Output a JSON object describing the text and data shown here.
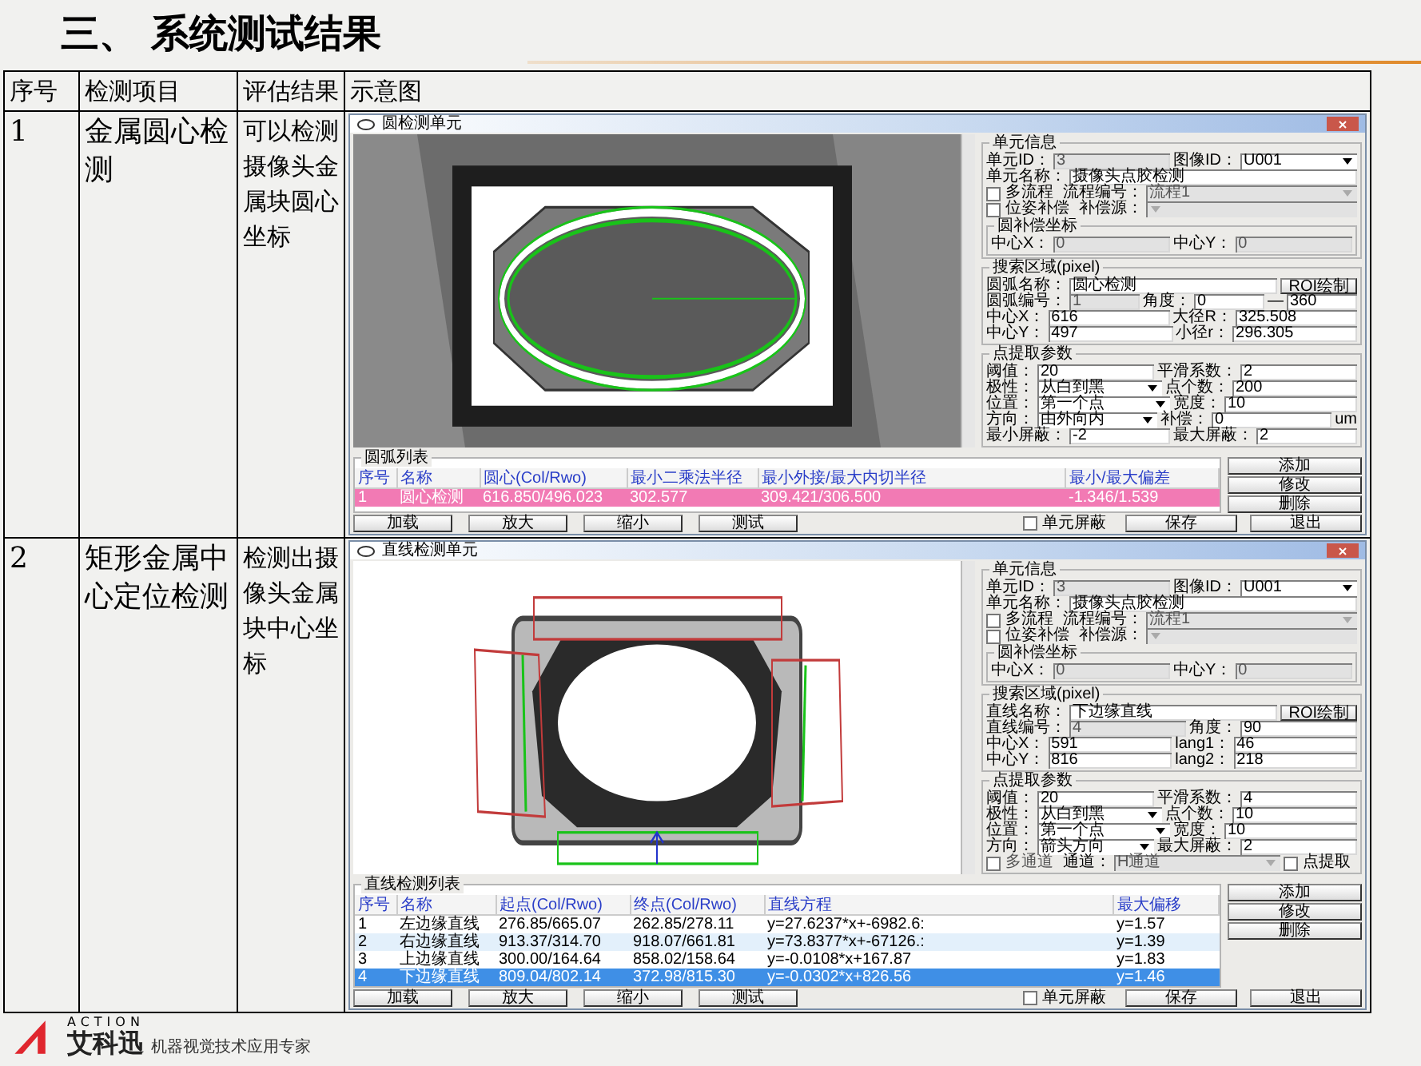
{
  "title": "三、 系统测试结果",
  "table": {
    "columns": [
      "序号",
      "检测项目",
      "评估结果",
      "示意图"
    ],
    "rows": [
      {
        "index": "1",
        "item": "金属圆心检测",
        "result": "可以检测摄像头金属块圆心坐标",
        "dialog": {
          "title": "圆检测单元",
          "kind": "circle",
          "groups": [
            {
              "title": "单元信息",
              "lines": [
                {
                  "items": [
                    {
                      "kind": "label",
                      "text": "单元ID："
                    },
                    {
                      "kind": "input",
                      "value": "3",
                      "disabled": true
                    },
                    {
                      "kind": "label",
                      "text": "图像ID："
                    },
                    {
                      "kind": "select",
                      "value": "U001",
                      "disabled": false
                    }
                  ]
                },
                {
                  "items": [
                    {
                      "kind": "label",
                      "text": "单元名称："
                    },
                    {
                      "kind": "input",
                      "value": "摄像头点胶检测",
                      "disabled": false
                    }
                  ]
                },
                {
                  "items": [
                    {
                      "kind": "check",
                      "label": "多流程",
                      "checked": false,
                      "disabled": false
                    },
                    {
                      "kind": "label",
                      "text": "流程编号："
                    },
                    {
                      "kind": "select",
                      "value": "流程1",
                      "disabled": true
                    }
                  ]
                },
                {
                  "items": [
                    {
                      "kind": "check",
                      "label": "位姿补偿",
                      "checked": false,
                      "disabled": false
                    },
                    {
                      "kind": "label",
                      "text": "补偿源："
                    },
                    {
                      "kind": "select",
                      "disabled": true
                    }
                  ]
                }
              ],
              "children": [
                {
                  "title": "圆补偿坐标",
                  "lines": [
                    {
                      "items": [
                        {
                          "kind": "label",
                          "text": "中心X："
                        },
                        {
                          "kind": "input",
                          "value": "0",
                          "disabled": true
                        },
                        {
                          "kind": "label",
                          "text": "中心Y："
                        },
                        {
                          "kind": "input",
                          "value": "0",
                          "disabled": true
                        }
                      ]
                    }
                  ]
                }
              ]
            },
            {
              "title": "搜索区域(pixel)",
              "lines": [
                {
                  "items": [
                    {
                      "kind": "label",
                      "text": "圆弧名称："
                    },
                    {
                      "kind": "input",
                      "value": "圆心检测",
                      "disabled": false
                    },
                    {
                      "kind": "button",
                      "label": "ROI绘制"
                    }
                  ]
                },
                {
                  "items": [
                    {
                      "kind": "label",
                      "text": "圆弧编号："
                    },
                    {
                      "kind": "input",
                      "value": "1",
                      "disabled": true
                    },
                    {
                      "kind": "label",
                      "text": "角度："
                    },
                    {
                      "kind": "input",
                      "value": "0",
                      "disabled": false
                    },
                    {
                      "kind": "label",
                      "text": "—"
                    },
                    {
                      "kind": "input",
                      "value": "360",
                      "disabled": false
                    }
                  ]
                },
                {
                  "items": [
                    {
                      "kind": "label",
                      "text": "中心X："
                    },
                    {
                      "kind": "input",
                      "value": "616",
                      "disabled": false
                    },
                    {
                      "kind": "label",
                      "text": "大径R："
                    },
                    {
                      "kind": "input",
                      "value": "325.508",
                      "disabled": false
                    }
                  ]
                },
                {
                  "items": [
                    {
                      "kind": "label",
                      "text": "中心Y："
                    },
                    {
                      "kind": "input",
                      "value": "497",
                      "disabled": false
                    },
                    {
                      "kind": "label",
                      "text": "小径r："
                    },
                    {
                      "kind": "input",
                      "value": "296.305",
                      "disabled": false
                    }
                  ]
                }
              ]
            },
            {
              "title": "点提取参数",
              "lines": [
                {
                  "items": [
                    {
                      "kind": "label",
                      "text": "阈值："
                    },
                    {
                      "kind": "input",
                      "value": "20",
                      "disabled": false
                    },
                    {
                      "kind": "label",
                      "text": "平滑系数："
                    },
                    {
                      "kind": "input",
                      "value": "2",
                      "disabled": false
                    }
                  ]
                },
                {
                  "items": [
                    {
                      "kind": "label",
                      "text": "极性："
                    },
                    {
                      "kind": "select",
                      "value": "从白到黑",
                      "disabled": false
                    },
                    {
                      "kind": "label",
                      "text": "点个数："
                    },
                    {
                      "kind": "input",
                      "value": "200",
                      "disabled": false
                    }
                  ]
                },
                {
                  "items": [
                    {
                      "kind": "label",
                      "text": "位置："
                    },
                    {
                      "kind": "select",
                      "value": "第一个点",
                      "disabled": false
                    },
                    {
                      "kind": "label",
                      "text": "宽度："
                    },
                    {
                      "kind": "input",
                      "value": "10",
                      "disabled": false
                    }
                  ]
                },
                {
                  "items": [
                    {
                      "kind": "label",
                      "text": "方向："
                    },
                    {
                      "kind": "select",
                      "value": "由外向内",
                      "disabled": false
                    },
                    {
                      "kind": "label",
                      "text": "补偿："
                    },
                    {
                      "kind": "input",
                      "value": "0",
                      "disabled": false
                    },
                    {
                      "kind": "label",
                      "text": "um"
                    }
                  ]
                },
                {
                  "items": [
                    {
                      "kind": "label",
                      "text": "最小屏蔽："
                    },
                    {
                      "kind": "input",
                      "value": "-2",
                      "disabled": false
                    },
                    {
                      "kind": "label",
                      "text": "最大屏蔽："
                    },
                    {
                      "kind": "input",
                      "value": "2",
                      "disabled": false
                    }
                  ]
                }
              ]
            }
          ],
          "list": {
            "title": "圆弧列表",
            "columns": [
              "序号",
              "名称",
              "圆心(Col/Rwo)",
              "最小二乘法半径",
              "最小外接/最大内切半径",
              "最小/最大偏差"
            ],
            "rows": [
              {
                "cells": [
                  "1",
                  "圆心检测",
                  "616.850/496.023",
                  "302.577",
                  "309.421/306.500",
                  "-1.346/1.539"
                ],
                "selected": true
              }
            ]
          },
          "side_buttons": [
            "添加",
            "修改",
            "删除"
          ],
          "tool_buttons": [
            "加载",
            "放大",
            "缩小",
            "测试"
          ],
          "mask": {
            "label": "单元屏蔽",
            "checked": false
          },
          "footer_buttons": [
            "保存",
            "退出"
          ]
        }
      },
      {
        "index": "2",
        "item": "矩形金属中心定位检测",
        "result": "检测出摄像头金属块中心坐标",
        "dialog": {
          "title": "直线检测单元",
          "kind": "line",
          "groups": [
            {
              "title": "单元信息",
              "lines": [
                {
                  "items": [
                    {
                      "kind": "label",
                      "text": "单元ID："
                    },
                    {
                      "kind": "input",
                      "value": "3",
                      "disabled": true
                    },
                    {
                      "kind": "label",
                      "text": "图像ID："
                    },
                    {
                      "kind": "select",
                      "value": "U001",
                      "disabled": false
                    }
                  ]
                },
                {
                  "items": [
                    {
                      "kind": "label",
                      "text": "单元名称："
                    },
                    {
                      "kind": "input",
                      "value": "摄像头点胶检测",
                      "disabled": false
                    }
                  ]
                },
                {
                  "items": [
                    {
                      "kind": "check",
                      "label": "多流程",
                      "checked": false,
                      "disabled": false
                    },
                    {
                      "kind": "label",
                      "text": "流程编号："
                    },
                    {
                      "kind": "select",
                      "value": "流程1",
                      "disabled": true
                    }
                  ]
                },
                {
                  "items": [
                    {
                      "kind": "check",
                      "label": "位姿补偿",
                      "checked": false,
                      "disabled": false
                    },
                    {
                      "kind": "label",
                      "text": "补偿源："
                    },
                    {
                      "kind": "select",
                      "disabled": true
                    }
                  ]
                }
              ],
              "children": [
                {
                  "title": "圆补偿坐标",
                  "lines": [
                    {
                      "items": [
                        {
                          "kind": "label",
                          "text": "中心X："
                        },
                        {
                          "kind": "input",
                          "value": "0",
                          "disabled": true
                        },
                        {
                          "kind": "label",
                          "text": "中心Y："
                        },
                        {
                          "kind": "input",
                          "value": "0",
                          "disabled": true
                        }
                      ]
                    }
                  ]
                }
              ]
            },
            {
              "title": "搜索区域(pixel)",
              "lines": [
                {
                  "items": [
                    {
                      "kind": "label",
                      "text": "直线名称："
                    },
                    {
                      "kind": "input",
                      "value": "下边缘直线",
                      "disabled": false
                    },
                    {
                      "kind": "button",
                      "label": "ROI绘制"
                    }
                  ]
                },
                {
                  "items": [
                    {
                      "kind": "label",
                      "text": "直线编号："
                    },
                    {
                      "kind": "input",
                      "value": "4",
                      "disabled": true
                    },
                    {
                      "kind": "label",
                      "text": "角度："
                    },
                    {
                      "kind": "input",
                      "value": "90",
                      "disabled": false
                    }
                  ]
                },
                {
                  "items": [
                    {
                      "kind": "label",
                      "text": "中心X："
                    },
                    {
                      "kind": "input",
                      "value": "591",
                      "disabled": false
                    },
                    {
                      "kind": "label",
                      "text": "lang1："
                    },
                    {
                      "kind": "input",
                      "value": "46",
                      "disabled": false
                    }
                  ]
                },
                {
                  "items": [
                    {
                      "kind": "label",
                      "text": "中心Y："
                    },
                    {
                      "kind": "input",
                      "value": "816",
                      "disabled": false
                    },
                    {
                      "kind": "label",
                      "text": "lang2："
                    },
                    {
                      "kind": "input",
                      "value": "218",
                      "disabled": false
                    }
                  ]
                }
              ]
            },
            {
              "title": "点提取参数",
              "lines": [
                {
                  "items": [
                    {
                      "kind": "label",
                      "text": "阈值："
                    },
                    {
                      "kind": "input",
                      "value": "20",
                      "disabled": false
                    },
                    {
                      "kind": "label",
                      "text": "平滑系数："
                    },
                    {
                      "kind": "input",
                      "value": "4",
                      "disabled": false
                    }
                  ]
                },
                {
                  "items": [
                    {
                      "kind": "label",
                      "text": "极性："
                    },
                    {
                      "kind": "select",
                      "value": "从白到黑",
                      "disabled": false
                    },
                    {
                      "kind": "label",
                      "text": "点个数："
                    },
                    {
                      "kind": "input",
                      "value": "10",
                      "disabled": false
                    }
                  ]
                },
                {
                  "items": [
                    {
                      "kind": "label",
                      "text": "位置："
                    },
                    {
                      "kind": "select",
                      "value": "第一个点",
                      "disabled": false
                    },
                    {
                      "kind": "label",
                      "text": "宽度："
                    },
                    {
                      "kind": "input",
                      "value": "10",
                      "disabled": false
                    }
                  ]
                },
                {
                  "items": [
                    {
                      "kind": "label",
                      "text": "方向："
                    },
                    {
                      "kind": "select",
                      "value": "箭头方向",
                      "disabled": false
                    },
                    {
                      "kind": "label",
                      "text": "最大屏蔽："
                    },
                    {
                      "kind": "input",
                      "value": "2",
                      "disabled": false
                    }
                  ]
                },
                {
                  "items": [
                    {
                      "kind": "check",
                      "label": "多通道",
                      "checked": false,
                      "disabled": true
                    },
                    {
                      "kind": "label",
                      "text": "通道："
                    },
                    {
                      "kind": "select",
                      "value": "H通道",
                      "disabled": true
                    },
                    {
                      "kind": "check",
                      "label": "点提取",
                      "checked": false,
                      "disabled": false
                    }
                  ]
                }
              ]
            }
          ],
          "list": {
            "title": "直线检测列表",
            "columns": [
              "序号",
              "名称",
              "起点(Col/Rwo)",
              "终点(Col/Rwo)",
              "直线方程",
              "最大偏移"
            ],
            "rows": [
              {
                "cells": [
                  "1",
                  "左边缘直线",
                  "276.85/665.07",
                  "262.85/278.11",
                  "y=27.6237*x+-6982.6:",
                  "y=1.57"
                ],
                "selected": false
              },
              {
                "cells": [
                  "2",
                  "右边缘直线",
                  "913.37/314.70",
                  "918.07/661.81",
                  "y=73.8377*x+-67126.:",
                  "y=1.39"
                ],
                "selected": false
              },
              {
                "cells": [
                  "3",
                  "上边缘直线",
                  "300.00/164.64",
                  "858.02/158.64",
                  "y=-0.0108*x+167.87",
                  "y=1.83"
                ],
                "selected": false
              },
              {
                "cells": [
                  "4",
                  "下边缘直线",
                  "809.04/802.14",
                  "372.98/815.30",
                  "y=-0.0302*x+826.56",
                  "y=1.46"
                ],
                "selected": true
              }
            ]
          },
          "side_buttons": [
            "添加",
            "修改",
            "删除"
          ],
          "tool_buttons": [
            "加载",
            "放大",
            "缩小",
            "测试"
          ],
          "mask": {
            "label": "单元屏蔽",
            "checked": false
          },
          "footer_buttons": [
            "保存",
            "退出"
          ]
        }
      }
    ]
  },
  "logo": {
    "wordmark": "ACTION",
    "name": "艾科迅",
    "tagline": "机器视觉技术应用专家"
  }
}
